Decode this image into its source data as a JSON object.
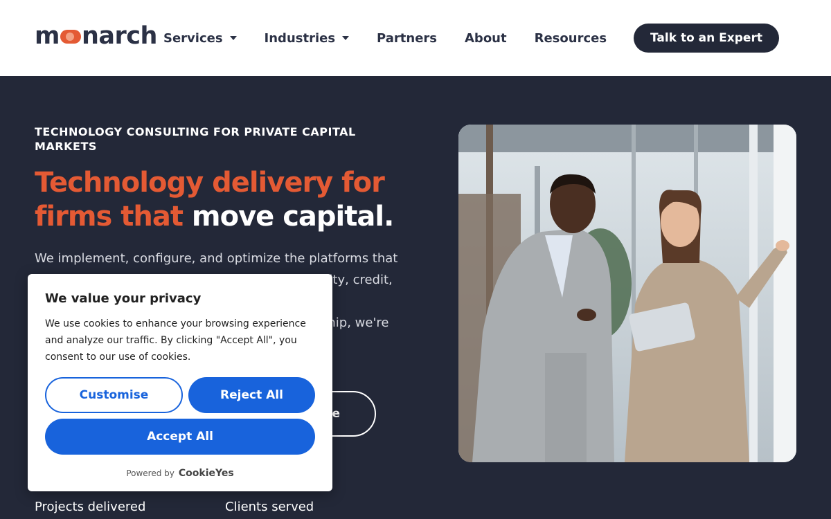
{
  "header": {
    "logo": "monarch",
    "nav": [
      {
        "label": "Services",
        "dropdown": true
      },
      {
        "label": "Industries",
        "dropdown": true
      },
      {
        "label": "Partners",
        "dropdown": false
      },
      {
        "label": "About",
        "dropdown": false
      },
      {
        "label": "Resources",
        "dropdown": false
      }
    ],
    "cta": "Talk to an Expert"
  },
  "hero": {
    "eyebrow": "TECHNOLOGY CONSULTING FOR PRIVATE CAPITAL MARKETS",
    "headline_accent": "Technology delivery for firms that",
    "headline_plain": "move capital.",
    "body_lines": [
      "We implement, configure, and optimize the platforms that",
      "uity, credit,",
      "ship, we're"
    ],
    "button_fragment": "e",
    "stats": [
      {
        "label": "Projects delivered"
      },
      {
        "label": "Clients served"
      }
    ]
  },
  "cookie_banner": {
    "title": "We value your privacy",
    "text": "We use cookies to enhance your browsing experience and analyze our traffic. By clicking \"Accept All\", you consent to our use of cookies.",
    "customise": "Customise",
    "reject": "Reject All",
    "accept": "Accept All",
    "powered_by": "Powered by",
    "brand": "CookieYes"
  },
  "colors": {
    "navy": "#232838",
    "accent": "#e45a34",
    "cookie_blue": "#1863dc"
  }
}
